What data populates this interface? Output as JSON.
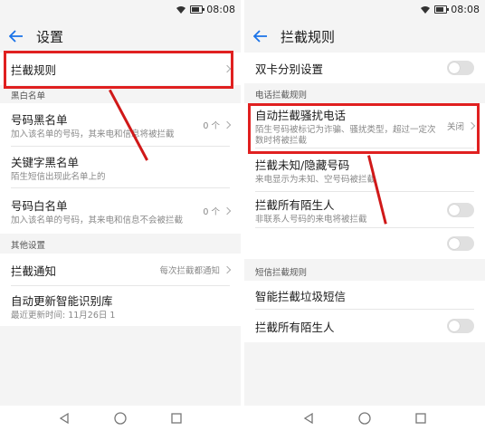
{
  "status": {
    "time": "08:08"
  },
  "left": {
    "title": "设置",
    "rows": {
      "intercept_rules": "拦截规则",
      "blacklist_section": "黑白名单",
      "number_blacklist": {
        "main": "号码黑名单",
        "sub": "加入该名单的号码，其来电和信息将被拦截",
        "value": "0 个"
      },
      "keyword_blacklist": {
        "main": "关键字黑名单",
        "sub": "陌生短信出现此名单上的"
      },
      "number_whitelist": {
        "main": "号码白名单",
        "sub": "加入该名单的号码，其来电和信息不会被拦截",
        "value": "0 个"
      },
      "other_section": "其他设置",
      "intercept_notify": {
        "main": "拦截通知",
        "value": "每次拦截都通知"
      },
      "auto_update": {
        "main": "自动更新智能识别库",
        "sub": "最近更新时间: 11月26日 1"
      }
    }
  },
  "right": {
    "title": "拦截规则",
    "rows": {
      "dual_sim": "双卡分别设置",
      "call_section": "电话拦截规则",
      "auto_block": {
        "main": "自动拦截骚扰电话",
        "sub": "陌生号码被标记为诈骗、骚扰类型，超过一定次数时将被拦截",
        "value": "关闭"
      },
      "block_unknown": {
        "main": "拦截未知/隐藏号码",
        "sub": "来电显示为未知、空号码被拦截"
      },
      "block_strangers": {
        "main": "拦截所有陌生人",
        "sub": "非联系人号码的来电将被拦截"
      },
      "sms_section": "短信拦截规则",
      "smart_spam": "智能拦截垃圾短信",
      "sms_strangers": "拦截所有陌生人"
    }
  },
  "icons": {
    "back": "back-arrow-icon",
    "nav_back": "triangle-back-icon",
    "nav_home": "circle-home-icon",
    "nav_recent": "square-recent-icon"
  },
  "colors": {
    "accent": "#1a73e8",
    "highlight": "#e02020",
    "toggle_off": "#e0e0e0"
  }
}
